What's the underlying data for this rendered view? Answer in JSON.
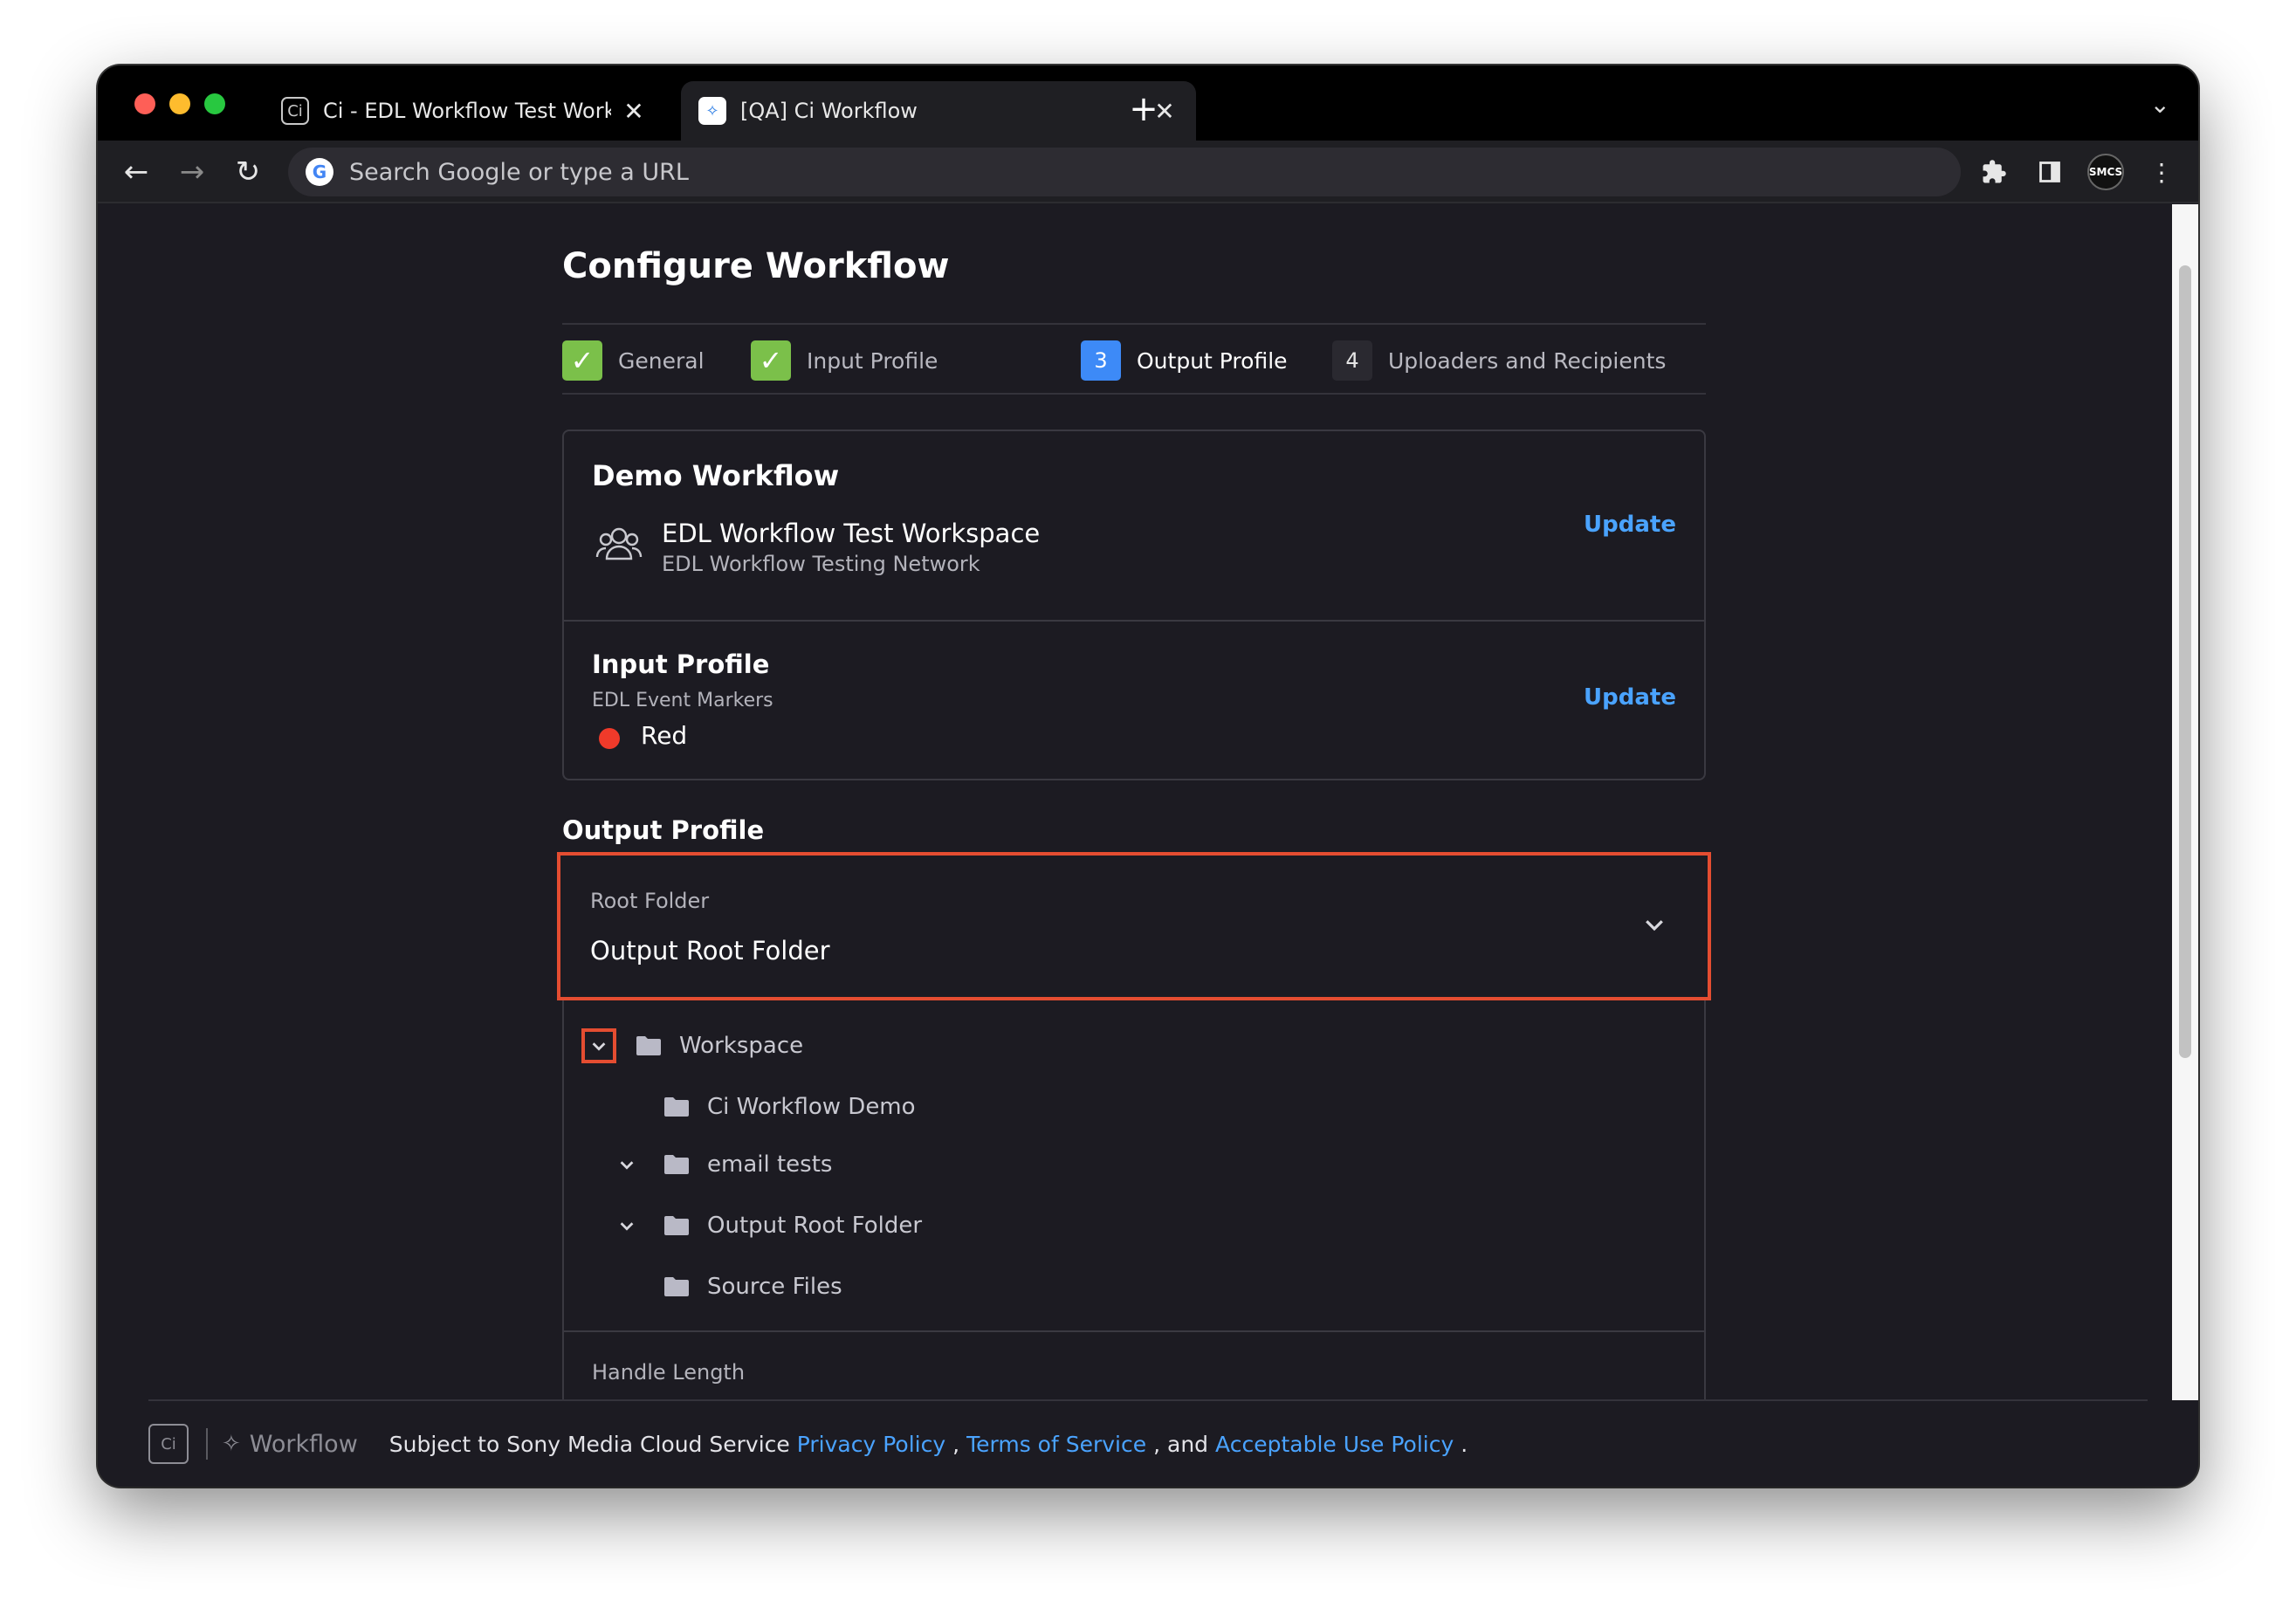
{
  "browser": {
    "tabs": [
      {
        "title": "Ci - EDL Workflow Test Worksp",
        "favicon": "ci-logo-icon",
        "favicon_text": "Ci"
      },
      {
        "title": "[QA] Ci Workflow",
        "favicon": "workflow-logo-icon",
        "favicon_text": "✧"
      }
    ],
    "omnibox_placeholder": "Search Google or type a URL",
    "google_glyph": "G",
    "avatar_text": "SMCS"
  },
  "page": {
    "title": "Configure Workflow",
    "steps": [
      {
        "number": "✓",
        "label": "General",
        "state": "done"
      },
      {
        "number": "✓",
        "label": "Input Profile",
        "state": "done"
      },
      {
        "number": "3",
        "label": "Output Profile",
        "state": "current"
      },
      {
        "number": "4",
        "label": "Uploaders and Recipients",
        "state": "pending"
      }
    ],
    "summary": {
      "workflow_name": "Demo Workflow",
      "workspace_name": "EDL Workflow Test Workspace",
      "network_name": "EDL Workflow Testing Network",
      "update_label": "Update",
      "input_profile_title": "Input Profile",
      "input_profile_sub": "EDL Event Markers",
      "marker_color_name": "Red",
      "marker_color": "#f03a2a"
    },
    "output_profile": {
      "heading": "Output Profile",
      "root_folder_label": "Root Folder",
      "root_folder_value": "Output Root Folder",
      "tree": [
        {
          "label": "Workspace",
          "depth": 0,
          "expandable": true
        },
        {
          "label": "Ci Workflow Demo",
          "depth": 1,
          "expandable": false
        },
        {
          "label": "email tests",
          "depth": 1,
          "expandable": true
        },
        {
          "label": "Output Root Folder",
          "depth": 1,
          "expandable": true
        },
        {
          "label": "Source Files",
          "depth": 1,
          "expandable": false
        }
      ],
      "handle_length_label": "Handle Length"
    },
    "footer": {
      "ci_logo_text": "Ci",
      "workflow_label": "Workflow",
      "text_prefix": "Subject to Sony Media Cloud Service",
      "privacy_link": "Privacy Policy",
      "comma": ",",
      "terms_link": "Terms of Service",
      "and_text": ", and",
      "aup_link": "Acceptable Use Policy",
      "period": "."
    }
  },
  "colors": {
    "accent": "#3d8af7",
    "link": "#4aa3ff",
    "done": "#7bc04a",
    "highlight": "#e44d31"
  }
}
